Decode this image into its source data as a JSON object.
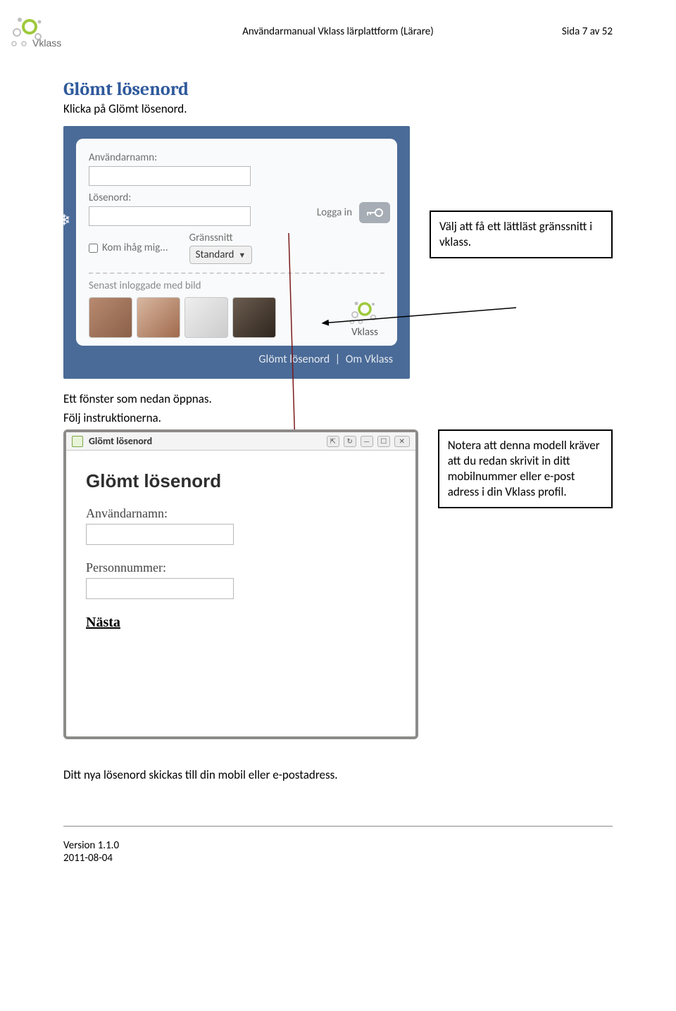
{
  "header": {
    "title": "Användarmanual Vklass lärplattform (Lärare)",
    "page_indicator": "Sida 7 av 52",
    "logo_text": "Vklass"
  },
  "section": {
    "heading": "Glömt lösenord",
    "intro": "Klicka på Glömt lösenord."
  },
  "login": {
    "username_label": "Användarnamn:",
    "password_label": "Lösenord:",
    "remember_label": "Kom ihåg mig...",
    "interface_label": "Gränssnitt",
    "interface_value": "Standard",
    "login_button": "Logga in",
    "recent_title": "Senast inloggade med bild",
    "brand": "Vklass",
    "footer_forgot": "Glömt lösenord",
    "footer_about": "Om Vklass"
  },
  "callout1": "Välj att få ett lättläst gränssnitt i vklass.",
  "mid_text1": "Ett fönster som nedan öppnas.",
  "mid_text2": "Följ instruktionerna.",
  "modal": {
    "titlebar": "Glömt lösenord",
    "heading": "Glömt lösenord",
    "username_label": "Användarnamn:",
    "personnr_label": "Personnummer:",
    "next": "Nästa"
  },
  "callout2": "Notera att denna modell kräver att du redan skrivit in ditt mobilnummer eller e-post adress i din Vklass profil.",
  "final": "Ditt nya lösenord skickas till din mobil eller e-postadress.",
  "footer": {
    "version": "Version 1.1.0",
    "date": "2011-08-04"
  }
}
